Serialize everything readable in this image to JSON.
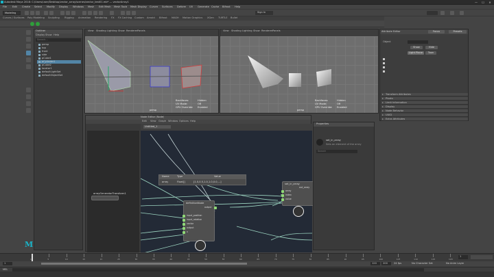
{
  "titlebar": {
    "title": "Autodesk Maya 2018: C:/Users/user/Desktop/vector_array/scenes/vector_test01.mb*  ---  vectorArray1",
    "min": "—",
    "max": "☐",
    "close": "✕"
  },
  "menubar": {
    "items": [
      "File",
      "Edit",
      "Create",
      "Select",
      "Modify",
      "Display",
      "Windows",
      "Mesh",
      "Edit Mesh",
      "Mesh Tools",
      "Mesh Display",
      "Curves",
      "Surfaces",
      "Deform",
      "UV",
      "Generate",
      "Cache",
      "Bifrost",
      "Help"
    ]
  },
  "statusline": {
    "workspace": "Modeling",
    "signin": "Sign In"
  },
  "shelf": {
    "tabs": [
      "Curves / Surfaces",
      "Poly Modeling",
      "Sculpting",
      "Rigging",
      "Animation",
      "Rendering",
      "FX",
      "FX Caching",
      "Custom",
      "Arnold",
      "Bifrost",
      "MASH",
      "Motion Graphics",
      "XGen",
      "TURTLE",
      "Bullet"
    ]
  },
  "outliner": {
    "title": "Outliner",
    "menu": [
      "Display",
      "Show",
      "Help"
    ],
    "search_placeholder": "Search...",
    "rows": [
      {
        "label": "persp",
        "selected": false
      },
      {
        "label": "top",
        "selected": false
      },
      {
        "label": "front",
        "selected": false
      },
      {
        "label": "side",
        "selected": false
      },
      {
        "label": "pCube1",
        "selected": false
      },
      {
        "label": "pCylinder1",
        "selected": true
      },
      {
        "label": "pCube2",
        "selected": false
      },
      {
        "label": "locator1",
        "selected": false
      },
      {
        "label": "defaultLightSet",
        "selected": false
      },
      {
        "label": "defaultObjectSet",
        "selected": false
      }
    ]
  },
  "viewport_left": {
    "menu": [
      "View",
      "Shading",
      "Lighting",
      "Show",
      "Renderer",
      "Panels"
    ],
    "camera": "persp",
    "hud": [
      "Backfaces:",
      "UV Mode:",
      "GPU Override:"
    ],
    "hud_values": [
      "Hidden",
      "Off",
      "Enabled"
    ]
  },
  "viewport_right": {
    "menu": [
      "View",
      "Shading",
      "Lighting",
      "Show",
      "Renderer",
      "Panels"
    ],
    "camera": "persp",
    "hud": [
      "Backfaces:",
      "UV Mode:",
      "GPU Override:"
    ],
    "hud_values": [
      "Hidden",
      "Off",
      "Enabled"
    ]
  },
  "attr_editor": {
    "title": "Attribute Editor",
    "btn_focus": "Focus",
    "btn_presets": "Presets",
    "node_label": "Object",
    "btn_show": "Show",
    "btn_hide": "Hide",
    "tab_a": "Light Plane",
    "tab_b": "Toon",
    "sections": [
      "Transform Attributes",
      "Pivots",
      "Limit Information",
      "Display",
      "Node Behavior",
      "UUID",
      "Extra Attributes"
    ]
  },
  "node_editor": {
    "title": "Node Editor (Node)",
    "menu": [
      "Edit",
      "View",
      "Graph",
      "Window",
      "Options",
      "Help"
    ],
    "tab": "Untitled_1",
    "left_node": "arrayGeneratorTransform1",
    "tooltip_header": [
      "Name",
      "Type",
      "Value"
    ],
    "tooltip_row": [
      "array",
      "Float[]",
      "[1.0,0.5,1.0,1.0,0.0,...]"
    ],
    "node_a": {
      "title": "definitionNode",
      "ports": [
        "input_position",
        "input_rotation",
        "vector",
        "output",
        "x"
      ]
    },
    "node_b": {
      "title": "set_in_array",
      "ports": [
        "array",
        "index",
        "value"
      ]
    },
    "node_a_out": "output",
    "node_b_out": "out_array"
  },
  "properties": {
    "title": "Properties",
    "node_name": "set_in_array",
    "node_desc": "Sets an element of the array",
    "search_placeholder": "Search"
  },
  "timeslider": {
    "ticks": [
      "1",
      "5",
      "10",
      "15",
      "20",
      "25",
      "30",
      "35",
      "40",
      "45",
      "50",
      "55",
      "60",
      "65",
      "70",
      "75",
      "80",
      "85",
      "90",
      "95",
      "100",
      "105",
      "110",
      "115",
      "120"
    ],
    "current": "1",
    "start": "1",
    "end": "120",
    "range_end": "200",
    "fps": "24 fps",
    "char_set": "No Character Set",
    "anim_layer": "No Anim Layer"
  },
  "cmdline": {
    "lang": "MEL"
  },
  "helpline": {
    "text": ""
  },
  "logo": {
    "mark": "M"
  },
  "colors": {
    "accent": "#5285a6",
    "port": "#8fd977",
    "canvas": "#232a36"
  }
}
